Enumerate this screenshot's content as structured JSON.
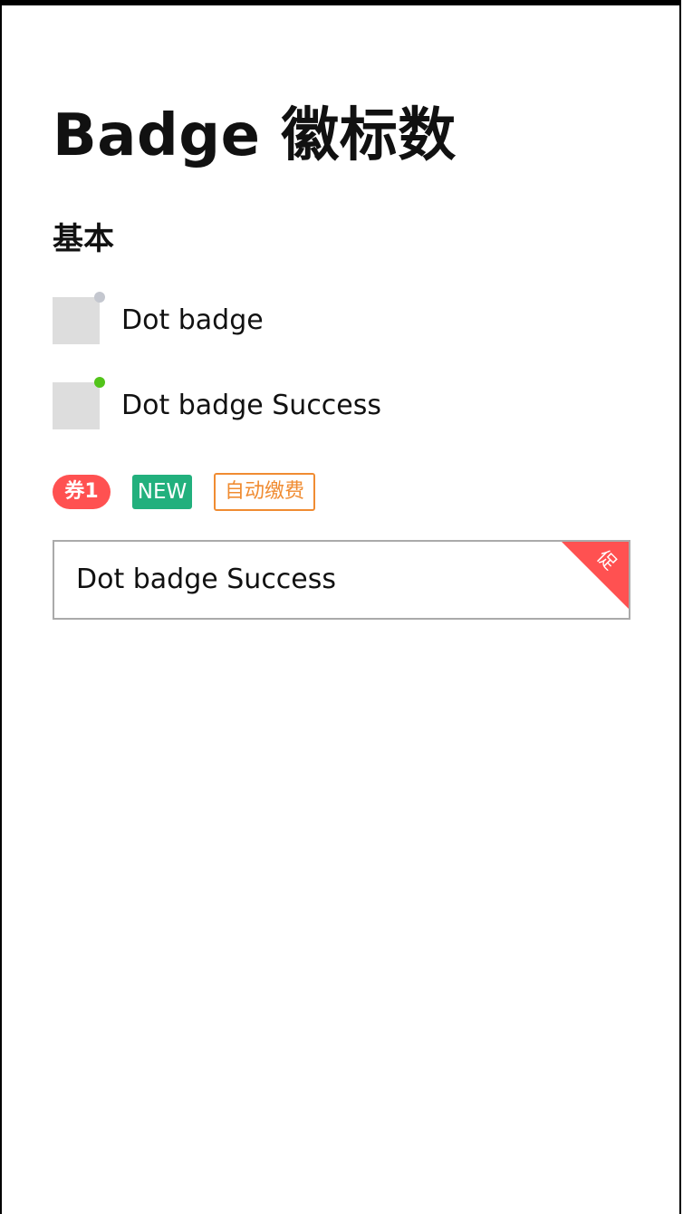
{
  "page": {
    "title": "Badge 徽标数"
  },
  "sections": {
    "basic_title": "基本"
  },
  "dot_badges": [
    {
      "label": "Dot badge",
      "dot_color": "#c4c7cf"
    },
    {
      "label": "Dot badge Success",
      "dot_color": "#52c41a"
    }
  ],
  "tags": {
    "coupon": {
      "text": "券1",
      "color": "#ff5151"
    },
    "new": {
      "text": "NEW",
      "color": "#22b07d"
    },
    "auto_pay": {
      "text": "自动缴费",
      "color": "#f08c32"
    }
  },
  "corner_card": {
    "label": "Dot badge Success",
    "corner_text": "促",
    "corner_color": "#ff5151"
  }
}
